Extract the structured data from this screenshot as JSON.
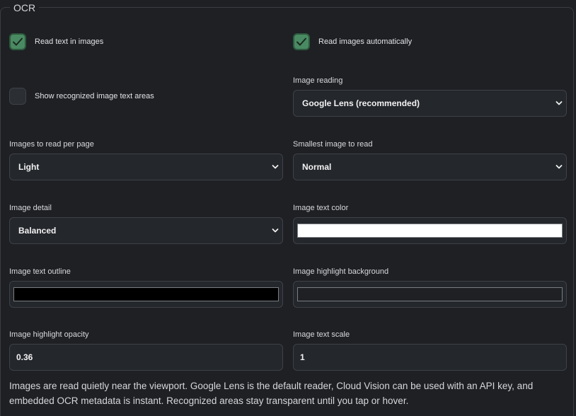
{
  "section": {
    "legend": "OCR"
  },
  "checkboxes": {
    "read_text": {
      "label": "Read text in images",
      "checked": true
    },
    "read_auto": {
      "label": "Read images automatically",
      "checked": true
    },
    "show_areas": {
      "label": "Show recognized image text areas",
      "checked": false
    }
  },
  "fields": {
    "image_reading": {
      "label": "Image reading",
      "value": "Google Lens (recommended)"
    },
    "images_per_page": {
      "label": "Images to read per page",
      "value": "Light"
    },
    "smallest_image": {
      "label": "Smallest image to read",
      "value": "Normal"
    },
    "image_detail": {
      "label": "Image detail",
      "value": "Balanced"
    },
    "text_color": {
      "label": "Image text color",
      "value": "#ffffff"
    },
    "text_outline": {
      "label": "Image text outline",
      "value": "#000000"
    },
    "highlight_bg": {
      "label": "Image highlight background",
      "value": "#1e2024"
    },
    "highlight_opacity": {
      "label": "Image highlight opacity",
      "value": "0.36"
    },
    "text_scale": {
      "label": "Image text scale",
      "value": "1"
    }
  },
  "help_text": "Images are read quietly near the viewport. Google Lens is the default reader, Cloud Vision can be used with an API key, and embedded OCR metadata is instant. Recognized areas stay transparent until you tap or hover.",
  "colors": {
    "background": "#1e2024",
    "checkbox_checked": "#4a8a63",
    "control_background": "#24272b",
    "border": "#3e4148"
  },
  "icons": {
    "check": "check-icon",
    "dropdown": "chevron-down-icon"
  }
}
